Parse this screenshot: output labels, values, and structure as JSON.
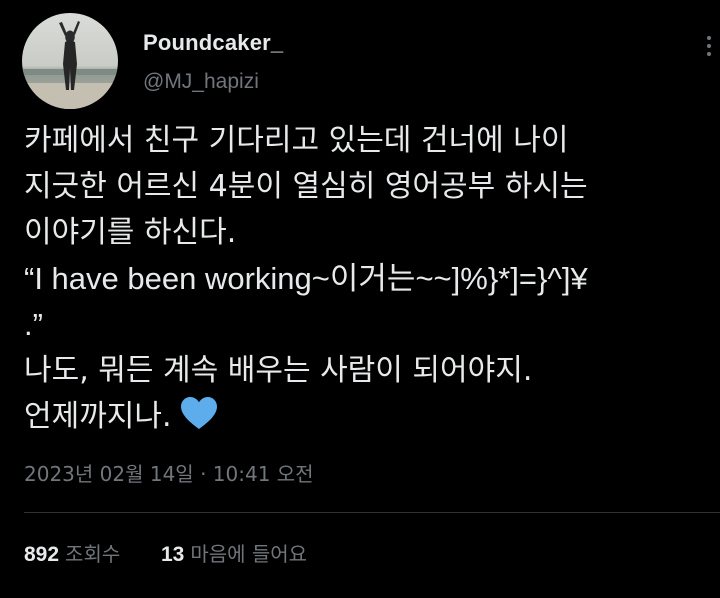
{
  "author": {
    "name": "Poundcaker_",
    "handle": "@MJ_hapizi"
  },
  "tweet": {
    "lines": [
      "카페에서 친구 기다리고 있는데 건너에 나이",
      "지긋한 어르신 4분이 열심히 영어공부 하시는",
      "이야기를 하신다.",
      "“I have been working~이거는~~]%}*]=}^]¥",
      ".”",
      "나도, 뭐든 계속 배우는 사람이 되어야지.",
      "언제까지나."
    ],
    "emoji": "blue-heart-icon",
    "timestamp": "2023년 02월 14일 · 10:41 오전"
  },
  "stats": {
    "views_count": "892",
    "views_label": "조회수",
    "likes_count": "13",
    "likes_label": "마음에 들어요"
  },
  "colors": {
    "background": "#000000",
    "primary_text": "#e7e9ea",
    "secondary_text": "#71767b",
    "divider": "#2f3336",
    "heart": "#5dadec"
  }
}
